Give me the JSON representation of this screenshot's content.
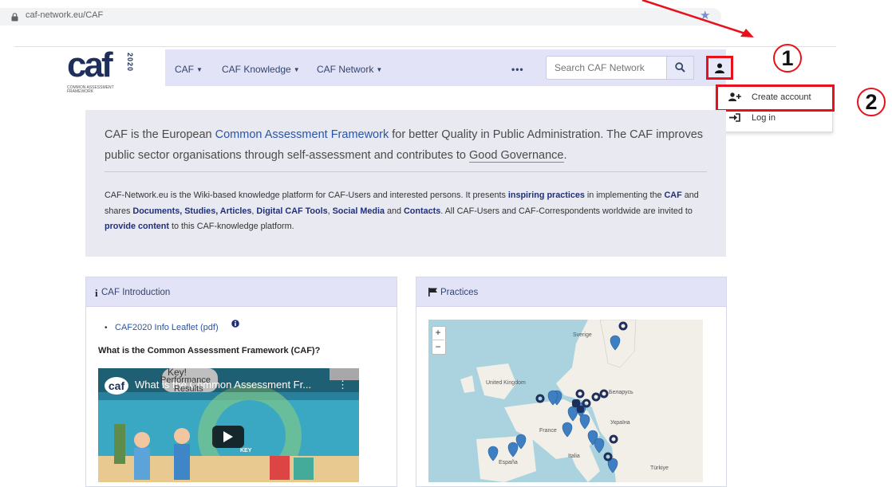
{
  "browser": {
    "url": "caf-network.eu/CAF"
  },
  "logo": {
    "word": "caf",
    "year": "2020",
    "subtitle": "COMMON ASSESSMENT FRAMEWORK"
  },
  "navbar": {
    "items": [
      {
        "label": "CAF"
      },
      {
        "label": "CAF Knowledge"
      },
      {
        "label": "CAF Network"
      }
    ],
    "more": "•••",
    "search_placeholder": "Search CAF Network"
  },
  "user_menu": {
    "items": [
      {
        "label": "Create account"
      },
      {
        "label": "Log in"
      }
    ]
  },
  "annotations": {
    "step1": "1",
    "step2": "2"
  },
  "intro": {
    "lead_1": "CAF is the European ",
    "lead_link": "Common Assessment Framework",
    "lead_2": " for better Quality in Public Administration. The CAF improves public sector organisations through self-assessment and contributes to ",
    "lead_link2": "Good Governance",
    "lead_3": ".",
    "body_1": "CAF-Network.eu is the Wiki-based knowledge platform for CAF-Users and interested persons. It presents ",
    "body_l1": "inspiring practices",
    "body_2": " in implementing the ",
    "body_l2": "CAF",
    "body_3": " and shares ",
    "body_l3": "Documents, Studies, Articles",
    "body_4": ", ",
    "body_l4": "Digital CAF Tools",
    "body_5": ", ",
    "body_l5": "Social Media",
    "body_6": " and ",
    "body_l6": "Contacts",
    "body_7": ". All CAF-Users and CAF-Correspondents worldwide are invited to ",
    "body_l7": "provide content",
    "body_8": " to this CAF-knowledge platform."
  },
  "card_intro": {
    "title": "CAF Introduction",
    "leaflet": "CAF2020 Info Leaflet (pdf)",
    "question": "What is the Common Assessment Framework (CAF)?",
    "video_title": "What is the Common Assessment Fr...",
    "video_bubble_1": "Key!",
    "video_bubble_2": "Performance",
    "video_bubble_3": "Results",
    "video_logo": "caf",
    "video_key": "KEY"
  },
  "card_practices": {
    "title": "Practices",
    "zoom_in": "+",
    "zoom_out": "−",
    "labels": [
      "Sverige",
      "United Kingdom",
      "Беларусь",
      "Україна",
      "France",
      "Italia",
      "España",
      "Türkiye"
    ]
  },
  "colors": {
    "accent_red": "#e8111b",
    "nav_bg": "#e2e3f7",
    "brand_navy": "#1f2f5c",
    "marker": "#3d7fc2"
  }
}
